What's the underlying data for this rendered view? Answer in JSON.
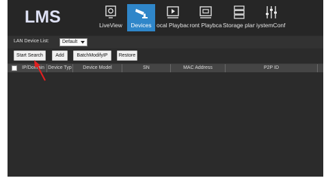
{
  "app": {
    "logo": "LMS"
  },
  "nav": [
    {
      "label": "LiveView",
      "icon": "liveview-icon"
    },
    {
      "label": "Devices",
      "icon": "devices-icon"
    },
    {
      "label": "ocal Playbac",
      "icon": "local-playback-icon"
    },
    {
      "label": "ront Playbca",
      "icon": "front-playback-icon"
    },
    {
      "label": "Storage plan",
      "icon": "storage-plan-icon"
    },
    {
      "label": "iystemConfi(",
      "icon": "system-config-icon"
    }
  ],
  "device_list": {
    "label": "LAN Device List:",
    "selected": "Default"
  },
  "toolbar": {
    "start_search": "Start Search",
    "add": "Add",
    "batch_modify_ip": "BatchModifyIP",
    "restore": "Restore"
  },
  "table": {
    "columns": [
      "IP/Domain",
      "Device Typ",
      "Device Model",
      "SN",
      "MAC Address",
      "P2P ID"
    ]
  },
  "colors": {
    "logo": "#c9cde6",
    "active_tab": "#2f86c9",
    "annotation_arrow": "#e02020"
  }
}
